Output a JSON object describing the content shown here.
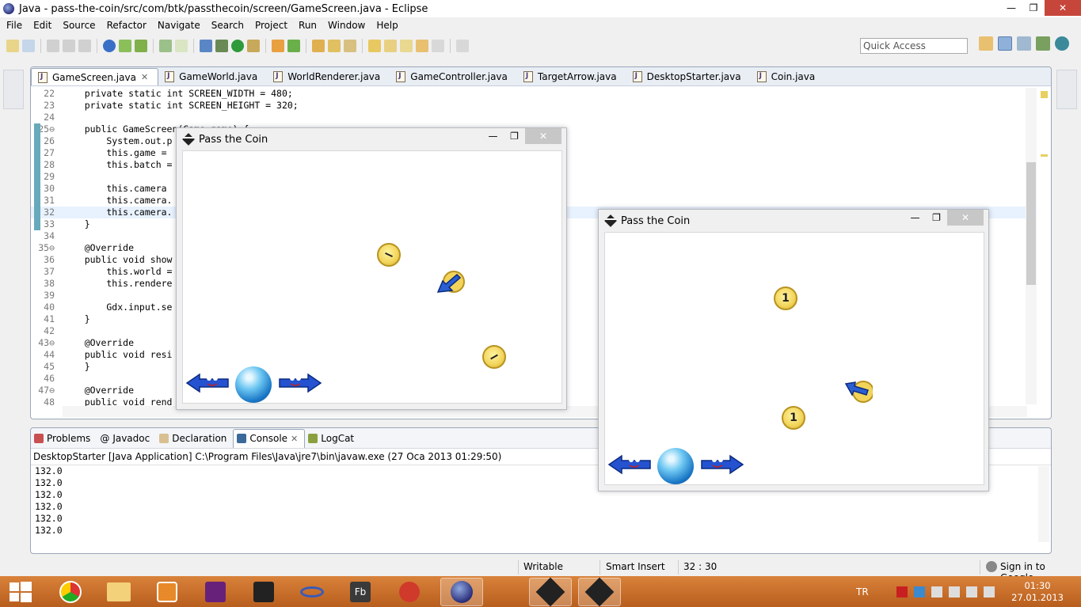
{
  "window": {
    "title": "Java - pass-the-coin/src/com/btk/passthecoin/screen/GameScreen.java - Eclipse",
    "min": "—",
    "max": "❐",
    "close": "✕"
  },
  "menu": [
    "File",
    "Edit",
    "Source",
    "Refactor",
    "Navigate",
    "Search",
    "Project",
    "Run",
    "Window",
    "Help"
  ],
  "quick_access": {
    "placeholder": "Quick Access"
  },
  "editor_tabs": [
    {
      "label": "GameScreen.java",
      "active": true,
      "close": "✕"
    },
    {
      "label": "GameWorld.java"
    },
    {
      "label": "WorldRenderer.java"
    },
    {
      "label": "GameController.java"
    },
    {
      "label": "TargetArrow.java"
    },
    {
      "label": "DesktopStarter.java"
    },
    {
      "label": "Coin.java"
    }
  ],
  "code_lines": [
    {
      "n": "22",
      "t": "    private static int SCREEN_WIDTH = 480;"
    },
    {
      "n": "23",
      "t": "    private static int SCREEN_HEIGHT = 320;"
    },
    {
      "n": "24",
      "t": ""
    },
    {
      "n": "25⊖",
      "t": "    public GameScreen(Game game) {"
    },
    {
      "n": "26",
      "t": "        System.out.p"
    },
    {
      "n": "27",
      "t": "        this.game = "
    },
    {
      "n": "28",
      "t": "        this.batch = "
    },
    {
      "n": "29",
      "t": ""
    },
    {
      "n": "30",
      "t": "        this.camera "
    },
    {
      "n": "31",
      "t": "        this.camera."
    },
    {
      "n": "32",
      "t": "        this.camera."
    },
    {
      "n": "33",
      "t": "    }"
    },
    {
      "n": "34",
      "t": ""
    },
    {
      "n": "35⊖",
      "t": "    @Override"
    },
    {
      "n": "36",
      "t": "    public void show"
    },
    {
      "n": "37",
      "t": "        this.world ="
    },
    {
      "n": "38",
      "t": "        this.rendere"
    },
    {
      "n": "39",
      "t": ""
    },
    {
      "n": "40",
      "t": "        Gdx.input.se"
    },
    {
      "n": "41",
      "t": "    }"
    },
    {
      "n": "42",
      "t": ""
    },
    {
      "n": "43⊖",
      "t": "    @Override"
    },
    {
      "n": "44",
      "t": "    public void resi"
    },
    {
      "n": "45",
      "t": "    }"
    },
    {
      "n": "46",
      "t": ""
    },
    {
      "n": "47⊖",
      "t": "    @Override"
    },
    {
      "n": "48",
      "t": "    public void rend"
    }
  ],
  "bottom_tabs": [
    {
      "label": "Problems"
    },
    {
      "label": "Javadoc",
      "prefix": "@"
    },
    {
      "label": "Declaration"
    },
    {
      "label": "Console",
      "active": true,
      "close": "✕"
    },
    {
      "label": "LogCat"
    }
  ],
  "console": {
    "header": "DesktopStarter [Java Application] C:\\Program Files\\Java\\jre7\\bin\\javaw.exe (27 Oca 2013 01:29:50)",
    "lines": [
      "132.0",
      "132.0",
      "132.0",
      "132.0",
      "132.0",
      "132.0"
    ]
  },
  "status": {
    "writable": "Writable",
    "insert": "Smart Insert",
    "position": "32 : 30",
    "signin": "Sign in to Google..."
  },
  "game_windows": [
    {
      "title": "Pass the Coin",
      "coins": [
        {
          "label": ""
        },
        {
          "label": ""
        }
      ]
    },
    {
      "title": "Pass the Coin",
      "coins": [
        {
          "label": "1"
        },
        {
          "label": "1"
        }
      ]
    }
  ],
  "taskbar": {
    "lang": "TR",
    "time": "01:30",
    "date": "27.01.2013"
  },
  "colors": {
    "accent": "#c7463b",
    "taskbar": "#c86e2c",
    "keyword": "#7f0055",
    "field": "#0000c0"
  }
}
